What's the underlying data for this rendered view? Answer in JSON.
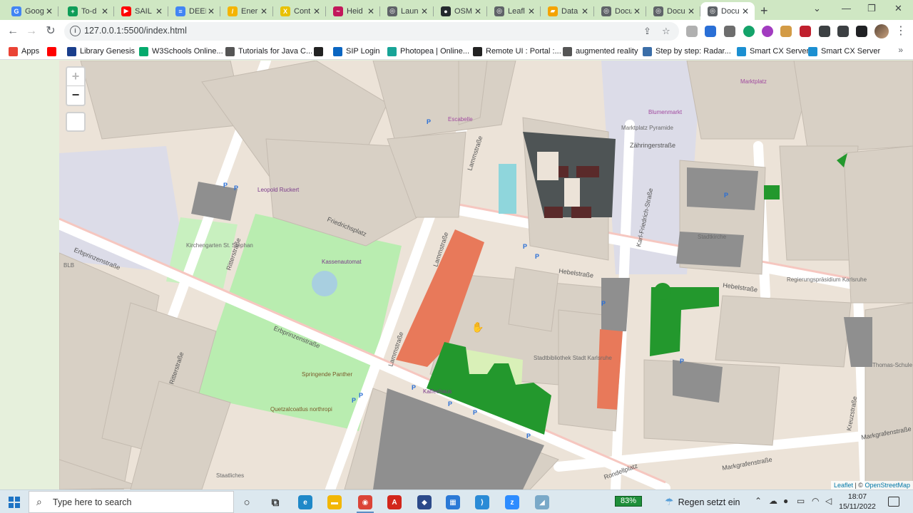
{
  "browser": {
    "tabs": [
      {
        "title": "Goog",
        "color": "#4285f4",
        "glyph": "G"
      },
      {
        "title": "To-d",
        "color": "#0f9d58",
        "glyph": "+"
      },
      {
        "title": "SAIL",
        "color": "#ff0000",
        "glyph": "▶"
      },
      {
        "title": "DEEI",
        "color": "#4285f4",
        "glyph": "≡"
      },
      {
        "title": "Ener",
        "color": "#f4b400",
        "glyph": "/"
      },
      {
        "title": "Cont",
        "color": "#e8c100",
        "glyph": "X"
      },
      {
        "title": "Heid",
        "color": "#c2185b",
        "glyph": "~"
      },
      {
        "title": "Laun",
        "color": "#5f6368",
        "glyph": "◎"
      },
      {
        "title": "OSM",
        "color": "#24292e",
        "glyph": "●"
      },
      {
        "title": "Leafl",
        "color": "#5f6368",
        "glyph": "◎"
      },
      {
        "title": "Data",
        "color": "#f4a300",
        "glyph": "▰"
      },
      {
        "title": "Docu",
        "color": "#5f6368",
        "glyph": "◎"
      },
      {
        "title": "Docu",
        "color": "#5f6368",
        "glyph": "◎"
      },
      {
        "title": "Docu",
        "color": "#5f6368",
        "glyph": "◎",
        "active": true
      }
    ],
    "new_tab": "+",
    "url": "127.0.0.1:5500/index.html",
    "bookmarks": [
      {
        "label": "Apps",
        "color": "#ea4335"
      },
      {
        "label": "",
        "color": "#ff0000"
      },
      {
        "label": "Library Genesis",
        "color": "#1a3e8c"
      },
      {
        "label": "W3Schools Online...",
        "color": "#04aa6d"
      },
      {
        "label": "Tutorials for Java C...",
        "color": "#555555"
      },
      {
        "label": "",
        "color": "#222222"
      },
      {
        "label": "SIP Login",
        "color": "#0a66c2"
      },
      {
        "label": "Photopea | Online...",
        "color": "#18a497"
      },
      {
        "label": "Remote UI : Portal :...",
        "color": "#222222"
      },
      {
        "label": "augmented reality",
        "color": "#555555"
      },
      {
        "label": "Step by step: Radar...",
        "color": "#3b6ea8"
      },
      {
        "label": "Smart CX Server",
        "color": "#1b8fd1"
      },
      {
        "label": "Smart CX Server",
        "color": "#1b8fd1"
      }
    ]
  },
  "map": {
    "zoom_in": "+",
    "zoom_out": "−",
    "attribution_leaflet": "Leaflet",
    "attribution_sep": " | © ",
    "attribution_osm": "OpenStreetMap",
    "street_labels": [
      "Erbprinzenstraße",
      "Erbprinzenstraße",
      "Friedrichsplatz",
      "Lammstraße",
      "Lammstraße",
      "Lammstraße",
      "Ritterstraße",
      "Ritterstraße",
      "Hebelstraße",
      "Hebelstraße",
      "Zähringerstraße",
      "Karl-Friedrich-Straße",
      "Markgrafenstraße",
      "Markgrafenstraße",
      "Rondellplatz",
      "Kreuzstraße"
    ],
    "poi_labels": [
      "Kirchengarten St. Stephan",
      "Kassenautomat",
      "Springende Panther",
      "Quetzalcoatlus northropi",
      "Stadtkirche",
      "Blumenmarkt",
      "Marktplatz Pyramide",
      "Regierungspräsidium Karlsruhe",
      "Stadtbibliothek Stadt Karlsruhe",
      "Thomas-Schule",
      "Staatliches",
      "Kaffeehaus",
      "Escabelle",
      "BLB",
      "Leopold Ruckert",
      "Marktplatz"
    ],
    "highlight_colors": {
      "green": "#23982d",
      "orange": "#e8795a",
      "dark": "#4e5455"
    }
  },
  "taskbar": {
    "search_placeholder": "Type here to search",
    "battery": "83%",
    "weather": "Regen setzt ein",
    "time": "18:07",
    "date": "15/11/2022",
    "apps": [
      {
        "name": "cortana-icon",
        "color": "#333333",
        "glyph": "○"
      },
      {
        "name": "task-view-icon",
        "color": "#333333",
        "glyph": "⧉"
      },
      {
        "name": "edge-icon",
        "color": "#1e88c8",
        "glyph": "e"
      },
      {
        "name": "file-explorer-icon",
        "color": "#f2b705",
        "glyph": "▬"
      },
      {
        "name": "chrome-icon",
        "color": "#db4437",
        "glyph": "◉"
      },
      {
        "name": "acrobat-icon",
        "color": "#d2261b",
        "glyph": "A"
      },
      {
        "name": "app-icon",
        "color": "#2c4a8a",
        "glyph": "◆"
      },
      {
        "name": "calendar-icon",
        "color": "#2b79d6",
        "glyph": "▦"
      },
      {
        "name": "vscode-icon",
        "color": "#2a8bd6",
        "glyph": "⟩"
      },
      {
        "name": "zoom-icon",
        "color": "#2d8cff",
        "glyph": "z"
      },
      {
        "name": "app-icon-2",
        "color": "#7aa9c8",
        "glyph": "◢"
      }
    ]
  }
}
